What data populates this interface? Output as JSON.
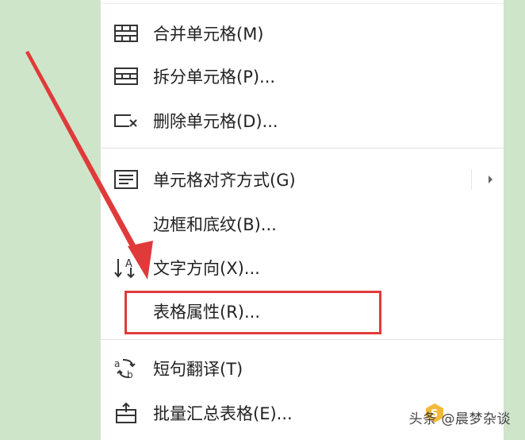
{
  "menu": {
    "items": [
      {
        "label": "合并单元格(M)",
        "icon": "merge-cells-icon"
      },
      {
        "label": "拆分单元格(P)...",
        "icon": "split-cells-icon"
      },
      {
        "label": "删除单元格(D)...",
        "icon": "delete-cells-icon"
      },
      {
        "label": "单元格对齐方式(G)",
        "icon": "cell-align-icon"
      },
      {
        "label": "边框和底纹(B)...",
        "icon": ""
      },
      {
        "label": "文字方向(X)...",
        "icon": "text-direction-icon"
      },
      {
        "label": "表格属性(R)...",
        "icon": ""
      },
      {
        "label": "短句翻译(T)",
        "icon": "translate-icon"
      },
      {
        "label": "批量汇总表格(E)...",
        "icon": "batch-summary-icon"
      }
    ]
  },
  "annotation": {
    "color": "#e03a3a"
  },
  "watermark": {
    "text": "头条 @晨梦杂谈"
  }
}
